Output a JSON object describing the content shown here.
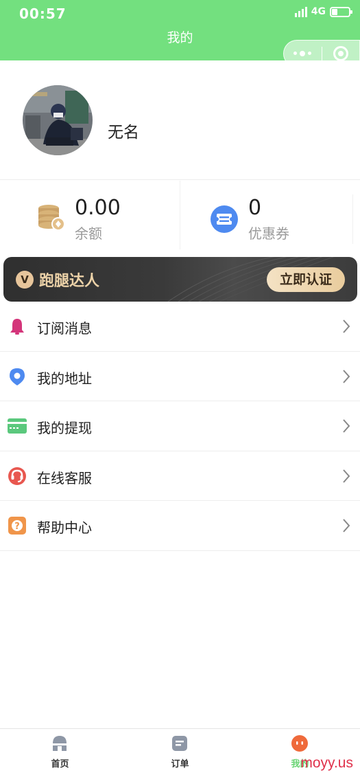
{
  "status_bar": {
    "time": "00:57",
    "network": "4G"
  },
  "header": {
    "title": "我的",
    "more_icon": "more-dots-icon",
    "close_icon": "target-circle-icon"
  },
  "profile": {
    "username": "无名"
  },
  "stats": {
    "balance": {
      "value": "0.00",
      "label": "余额",
      "icon": "coins-icon"
    },
    "coupon": {
      "value": "0",
      "label": "优惠券",
      "icon": "ticket-icon"
    }
  },
  "banner": {
    "badge": "V",
    "title": "跑腿达人",
    "button_label": "立即认证"
  },
  "menu": {
    "items": [
      {
        "label": "订阅消息",
        "icon": "bell-icon"
      },
      {
        "label": "我的地址",
        "icon": "location-pin-icon"
      },
      {
        "label": "我的提现",
        "icon": "card-icon"
      },
      {
        "label": "在线客服",
        "icon": "headset-icon"
      },
      {
        "label": "帮助中心",
        "icon": "question-icon"
      }
    ]
  },
  "tabbar": {
    "tabs": [
      {
        "label": "首页",
        "icon": "home-icon"
      },
      {
        "label": "订单",
        "icon": "order-icon"
      },
      {
        "label": "我的",
        "icon": "mine-icon",
        "active": true
      }
    ]
  },
  "watermark": "moyy.us",
  "colors": {
    "header_green": "#73e07f",
    "active_tab": "#6ad474",
    "banner_gold": "#ecd2a8",
    "watermark": "#e0314b"
  }
}
